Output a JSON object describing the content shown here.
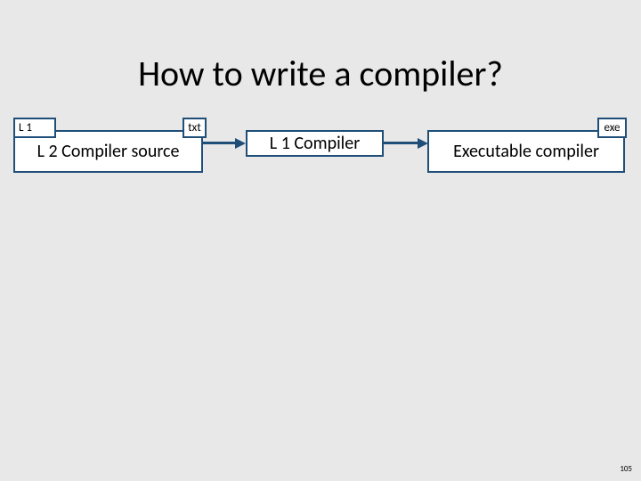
{
  "title": "How to write a compiler?",
  "boxes": {
    "l1_label": "L 1",
    "source_label": "L 2 Compiler source",
    "txt_label": "txt",
    "l1_compiler_label": "L 1 Compiler",
    "exe_label": "exe",
    "exec_compiler_label": "Executable compiler"
  },
  "page_number": "105",
  "colors": {
    "border": "#1f4e79",
    "background": "#e8e8e8"
  }
}
